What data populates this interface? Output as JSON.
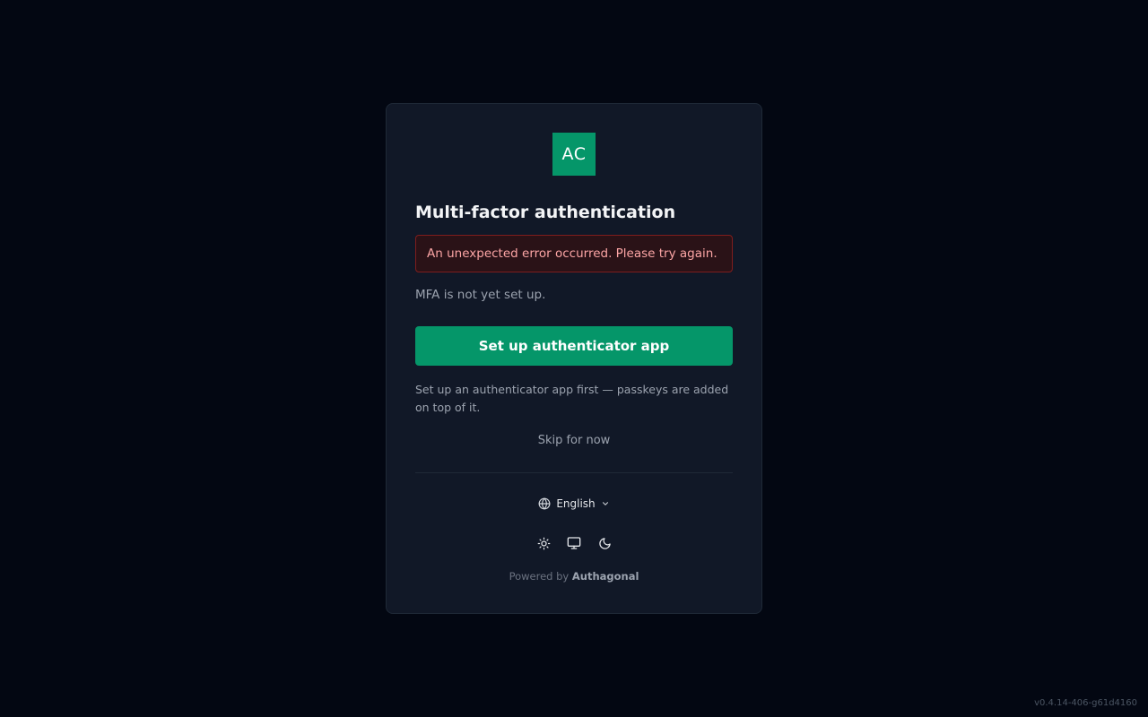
{
  "logo": {
    "text": "AC",
    "color": "#059669"
  },
  "auth": {
    "title": "Multi-factor authentication",
    "error_message": "An unexpected error occurred. Please try again.",
    "status": "MFA is not yet set up.",
    "setup_button_label": "Set up authenticator app",
    "hint": "Set up an authenticator app first — passkeys are added on top of it.",
    "skip_label": "Skip for now"
  },
  "footer": {
    "language": {
      "selected": "English",
      "icon": "globe-icon",
      "chevron": "chevron-down-icon"
    },
    "theme_options": [
      {
        "name": "light",
        "icon": "sun-icon"
      },
      {
        "name": "system",
        "icon": "monitor-icon"
      },
      {
        "name": "dark",
        "icon": "moon-icon"
      }
    ],
    "powered_prefix": "Powered by",
    "powered_brand": "Authagonal"
  },
  "version": "v0.4.14-406-g61d4160",
  "colors": {
    "background": "#030712",
    "card": "#111827",
    "accent": "#059669",
    "error_text": "#fca5a5",
    "error_border": "#7f1d1d"
  }
}
